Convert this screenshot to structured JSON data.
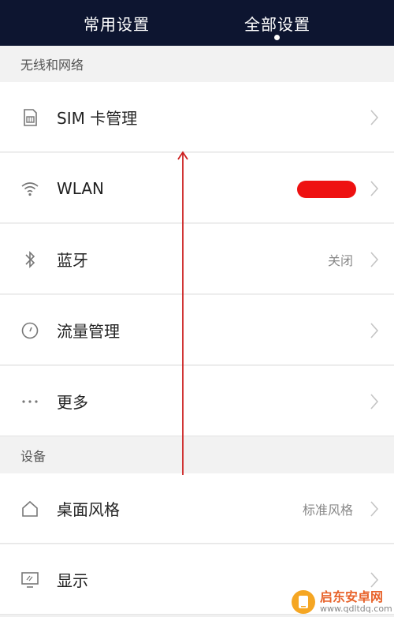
{
  "tabs": [
    {
      "label": "常用设置",
      "selected": false
    },
    {
      "label": "全部设置",
      "selected": true
    }
  ],
  "sections": [
    {
      "header": "无线和网络",
      "items": [
        {
          "label": "SIM 卡管理",
          "value": "",
          "icon": "sim-card-icon"
        },
        {
          "label": "WLAN",
          "value": "",
          "icon": "wifi-icon",
          "value_redacted": true
        },
        {
          "label": "蓝牙",
          "value": "关闭",
          "icon": "bluetooth-icon"
        },
        {
          "label": "流量管理",
          "value": "",
          "icon": "data-usage-icon"
        },
        {
          "label": "更多",
          "value": "",
          "icon": "more-icon"
        }
      ]
    },
    {
      "header": "设备",
      "items": [
        {
          "label": "桌面风格",
          "value": "标准风格",
          "icon": "home-icon"
        },
        {
          "label": "显示",
          "value": "",
          "icon": "display-icon"
        }
      ]
    }
  ],
  "watermark": {
    "name": "启东安卓网",
    "url": "www.qdltdq.com"
  },
  "colors": {
    "topbar": "#0d1530",
    "annotation": "#cc1f1f",
    "redaction": "#ee1111"
  }
}
